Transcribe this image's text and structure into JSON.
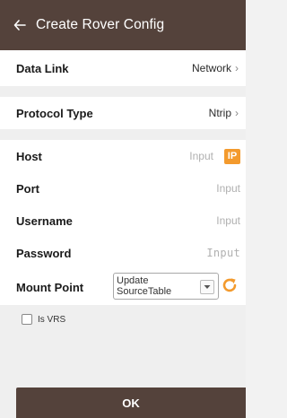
{
  "header": {
    "title": "Create Rover Config"
  },
  "data_link": {
    "label": "Data Link",
    "value": "Network"
  },
  "protocol": {
    "label": "Protocol Type",
    "value": "Ntrip"
  },
  "host": {
    "label": "Host",
    "placeholder": "Input",
    "badge": "IP"
  },
  "port": {
    "label": "Port",
    "placeholder": "Input"
  },
  "username": {
    "label": "Username",
    "placeholder": "Input"
  },
  "password": {
    "label": "Password",
    "placeholder": "Input"
  },
  "mount_point": {
    "label": "Mount Point",
    "select_line1": "Update",
    "select_line2": "SourceTable"
  },
  "is_vrs": {
    "label": "Is VRS",
    "checked": false
  },
  "ok_button": {
    "label": "OK"
  },
  "colors": {
    "header": "#54423b",
    "accent": "#f39a2d"
  },
  "icons": {
    "back": "back-arrow-icon",
    "chevron": "chevron-right-icon",
    "refresh": "refresh-icon",
    "dropdown": "dropdown-arrow-icon"
  }
}
